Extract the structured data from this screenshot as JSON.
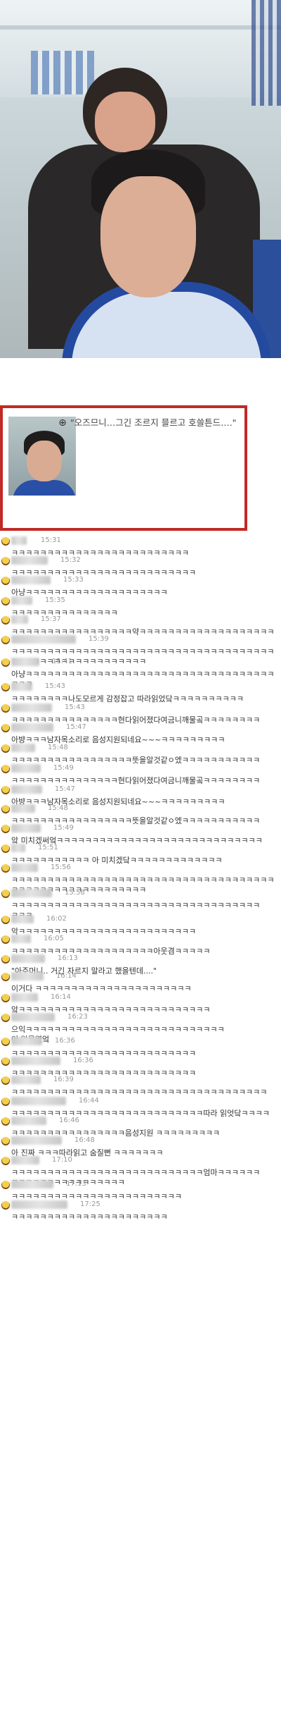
{
  "photo": {
    "alt_icons": [
      "salon-photo"
    ]
  },
  "highlight": {
    "zoom_icon": "magnifier-icon",
    "quote": "\"오즈므니…그긴 조르지 믈르고 호쓸튼드….\""
  },
  "messages": [
    {
      "time": "15:31",
      "text": "ㅋㅋㅋㅋㅋㅋㅋㅋㅋㅋㅋㅋㅋㅋㅋㅋㅋㅋㅋㅋㅋㅋㅋㅋㅋ"
    },
    {
      "time": "15:32",
      "text": "ㅋㅋㅋㅋㅋㅋㅋㅋㅋㅋㅋㅋㅋㅋㅋㅋㅋㅋㅋㅋㅋㅋㅋㅋㅋㅋ"
    },
    {
      "time": "15:33",
      "text": "아냥ㅋㅋㅋㅋㅋㅋㅋㅋㅋㅋㅋㅋㅋㅋㅋㅋㅋㅋㅋㅋ"
    },
    {
      "time": "15:35",
      "text": "ㅋㅋㅋㅋㅋㅋㅋㅋㅋㅋㅋㅋㅋㅋㅋ"
    },
    {
      "time": "15:37",
      "text": "ㅋㅋㅋㅋㅋㅋㅋㅋㅋㅋㅋㅋㅋㅋㅋㅋㅋ약ㅋㅋㅋㅋㅋㅋㅋㅋㅋㅋㅋㅋㅋㅋㅋㅋㅋㅋㅋ"
    },
    {
      "time": "15:39",
      "text": "ㅋㅋㅋㅋㅋㅋㅋㅋㅋㅋㅋㅋㅋㅋㅋㅋㅋㅋㅋㅋㅋㅋㅋㅋㅋㅋㅋㅋㅋㅋㅋㅋㅋㅋㅋㅋㅋㅋㅋㅋㅋㅋㅋㅋㅋㅋㅋㅋㅋㅋㅋㅋㅋㅋㅋㅋ"
    },
    {
      "time": "15:41",
      "text": "아냥ㅋㅋㅋㅋㅋㅋㅋㅋㅋㅋㅋㅋㅋㅋㅋㅋㅋㅋㅋㅋㅋㅋㅋㅋㅋㅋㅋㅋㅋㅋㅋㅋㅋㅋㅋㅋㅋㅋ"
    },
    {
      "time": "15:43",
      "text": "ㅋㅋㅋㅋㅋㅋㅋㅋ나도모르게 감정잡고 따라읽었닼ㅋㅋㅋㅋㅋㅋㅋㅋㅋㅋ"
    },
    {
      "time": "15:43",
      "text": "ㅋㅋㅋㅋㅋㅋㅋㅋㅋㅋㅋㅋㅋㅋㅋ현다읽어졌다여금니깨물곸ㅋㅋㅋㅋㅋㅋㅋㅋ"
    },
    {
      "time": "15:47",
      "text": "아뱡ㅋㅋㅋ남자목소리로 음성지원되네요~~~ㅋㅋㅋㅋㅋㅋㅋㅋㅋ"
    },
    {
      "time": "15:48",
      "text": "ㅋㅋㅋㅋㅋㅋㅋㅋㅋㅋㅋㅋㅋㅋㅋㅋㅋ뜻을알것같ㅇ엤ㅋㅋㅋㅋㅋㅋㅋㅋㅋㅋㅋ"
    },
    {
      "time": "15:49",
      "text": "ㅋㅋㅋㅋㅋㅋㅋㅋㅋㅋㅋㅋㅋㅋㅋ현다읽어졌다여금니깨물곸ㅋㅋㅋㅋㅋㅋㅋㅋ"
    },
    {
      "time": "15:47",
      "text": "아뱡ㅋㅋㅋ남자목소리로 음성지원되네요~~~ㅋㅋㅋㅋㅋㅋㅋㅋㅋ"
    },
    {
      "time": "15:48",
      "text": "ㅋㅋㅋㅋㅋㅋㅋㅋㅋㅋㅋㅋㅋㅋㅋㅋㅋ뜻을알것같ㅇ엤ㅋㅋㅋㅋㅋㅋㅋㅋㅋㅋㅋ"
    },
    {
      "time": "15:49",
      "text": "앜 미치겠써엌ㅋㅋㅋㅋㅋㅋㅋㅋㅋㅋㅋㅋㅋㅋㅋㅋㅋㅋㅋㅋㅋㅋㅋㅋㅋㅋㅋㅋㅋ"
    },
    {
      "time": "15:51",
      "text": "ㅋㅋㅋㅋㅋㅋㅋㅋㅋㅋㅋ 아 미치겠닼ㅋㅋㅋㅋㅋㅋㅋㅋㅋㅋㅋㅋㅋ"
    },
    {
      "time": "15:56",
      "text": "ㅋㅋㅋㅋㅋㅋㅋㅋㅋㅋㅋㅋㅋㅋㅋㅋㅋㅋㅋㅋㅋㅋㅋㅋㅋㅋㅋㅋㅋㅋㅋㅋㅋㅋㅋㅋㅋㅋㅋㅋㅋㅋㅋㅋㅋㅋㅋㅋㅋㅋㅋㅋㅋㅋㅋㅋ"
    },
    {
      "time": "15:58",
      "text": "ㅋㅋㅋㅋㅋㅋㅋㅋㅋㅋㅋㅋㅋㅋㅋㅋㅋㅋㅋㅋㅋㅋㅋㅋㅋㅋㅋㅋㅋㅋㅋㅋㅋㅋㅋ\nㅋㅋㅋ"
    },
    {
      "time": "16:02",
      "text": "악ㅋㅋㅋㅋㅋㅋㅋㅋㅋㅋㅋㅋㅋㅋㅋㅋㅋㅋㅋㅋㅋㅋㅋㅋㅋ"
    },
    {
      "time": "16:05",
      "text": "ㅋㅋㅋㅋㅋㅋㅋㅋㅋㅋㅋㅋㅋㅋㅋㅋㅋㅋㅋㅋ아웃겸ㅋㅋㅋㅋㅋ"
    },
    {
      "time": "16:13",
      "text": "\"아주머니.. 거긴 자르지 말라고 했을텐데....\""
    },
    {
      "time": "16:14",
      "text": "이거다 ㅋㅋㅋㅋㅋㅋㅋㅋㅋㅋㅋㅋㅋㅋㅋㅋㅋㅋㅋㅋㅋㅋ"
    },
    {
      "time": "16:14",
      "text": "앜ㅋㅋㅋㅋㅋㅋㅋㅋㅋㅋㅋㅋㅋㅋㅋㅋㅋㅋㅋㅋㅋㅋㅋㅋㅋㅋㅋ"
    },
    {
      "time": "16:23",
      "text": "으익ㅋㅋㅋㅋㅋㅋㅋㅋㅋㅋㅋㅋㅋㅋㅋㅋㅋㅋㅋㅋㅋㅋㅋㅋㅋㅋㅋㅋ\n이 악몽였엌"
    },
    {
      "time": "16:36",
      "text": "ㅋㅋㅋㅋㅋㅋㅋㅋㅋㅋㅋㅋㅋㅋㅋㅋㅋㅋㅋㅋㅋㅋㅋㅋㅋㅋ"
    },
    {
      "time": "16:36",
      "text": "ㅋㅋㅋㅋㅋㅋㅋㅋㅋㅋㅋㅋㅋㅋㅋㅋㅋㅋㅋㅋㅋㅋㅋㅋㅋㅋ"
    },
    {
      "time": "16:39",
      "text": "ㅋㅋㅋㅋㅋㅋㅋㅋㅋㅋㅋㅋㅋㅋㅋㅋㅋㅋㅋㅋㅋㅋㅋㅋㅋㅋㅋㅋㅋㅋㅋㅋㅋㅋㅋㅋ"
    },
    {
      "time": "16:44",
      "text": "ㅋㅋㅋㅋㅋㅋㅋㅋㅋㅋㅋㅋㅋㅋㅋㅋㅋㅋㅋㅋㅋㅋㅋㅋㅋㅋㅋ따라 읽엇닼ㅋㅋㅋㅋ"
    },
    {
      "time": "16:46",
      "text": "ㅋㅋㅋㅋㅋㅋㅋㅋㅋㅋㅋㅋㅋㅋㅋㅋ음성지원 ㅋㅋㅋㅋㅋㅋㅋㅋㅋ"
    },
    {
      "time": "16:48",
      "text": "아 진짜 ㅋㅋㅋ따라읽고 숨질뻔 ㅋㅋㅋㅋㅋㅋㅋ"
    },
    {
      "time": "17:10",
      "text": "ㅋㅋㅋㅋㅋㅋㅋㅋㅋㅋㅋㅋㅋㅋㅋㅋㅋㅋㅋㅋㅋㅋㅋㅋㅋㅋㅋ엄마ㅋㅋㅋㅋㅋㅋ\nㅋㅋㅋㅋㅋㅋㅋㅋㅋㅋㅋㅋㅋㅋㅋㅋ"
    },
    {
      "time": "17:13",
      "text": "ㅋㅋㅋㅋㅋㅋㅋㅋㅋㅋㅋㅋㅋㅋㅋㅋㅋㅋㅋㅋㅋㅋㅋㅋ"
    },
    {
      "time": "17:25",
      "text": "ㅋㅋㅋㅋㅋㅋㅋㅋㅋㅋㅋㅋㅋㅋㅋㅋㅋㅋㅋㅋㅋㅋ"
    }
  ]
}
